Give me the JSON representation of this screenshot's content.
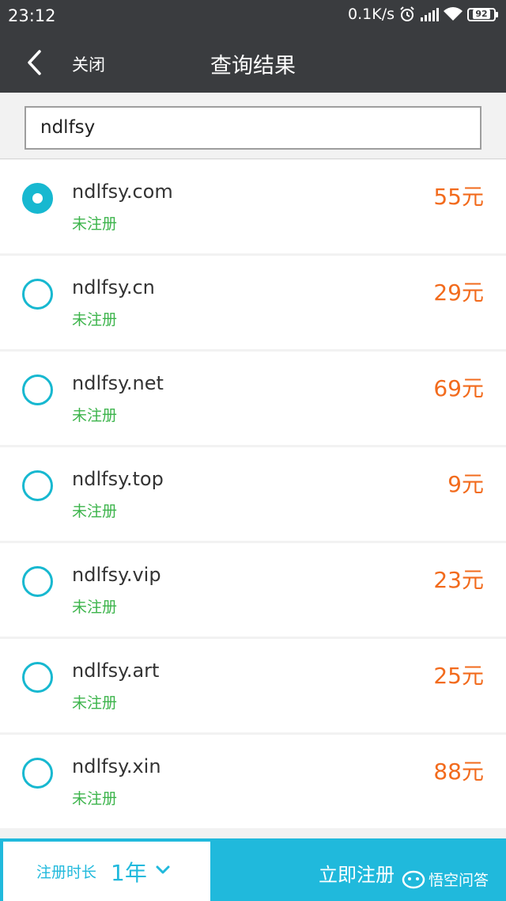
{
  "statusbar": {
    "time": "23:12",
    "speed": "0.1K/s",
    "battery": "92"
  },
  "nav": {
    "close": "关闭",
    "title": "查询结果"
  },
  "search": {
    "value": "ndlfsy"
  },
  "results": [
    {
      "domain": "ndlfsy.com",
      "status": "未注册",
      "price": "55元",
      "selected": true
    },
    {
      "domain": "ndlfsy.cn",
      "status": "未注册",
      "price": "29元",
      "selected": false
    },
    {
      "domain": "ndlfsy.net",
      "status": "未注册",
      "price": "69元",
      "selected": false
    },
    {
      "domain": "ndlfsy.top",
      "status": "未注册",
      "price": "9元",
      "selected": false
    },
    {
      "domain": "ndlfsy.vip",
      "status": "未注册",
      "price": "23元",
      "selected": false
    },
    {
      "domain": "ndlfsy.art",
      "status": "未注册",
      "price": "25元",
      "selected": false
    },
    {
      "domain": "ndlfsy.xin",
      "status": "未注册",
      "price": "88元",
      "selected": false
    }
  ],
  "bottom": {
    "duration_label": "注册时长",
    "duration_value": "1年",
    "register": "立即注册"
  },
  "watermark": "悟空问答",
  "colors": {
    "accent": "#20b9dc",
    "price": "#f26b1d",
    "status": "#3cb44b",
    "header": "#3a3c3f"
  }
}
